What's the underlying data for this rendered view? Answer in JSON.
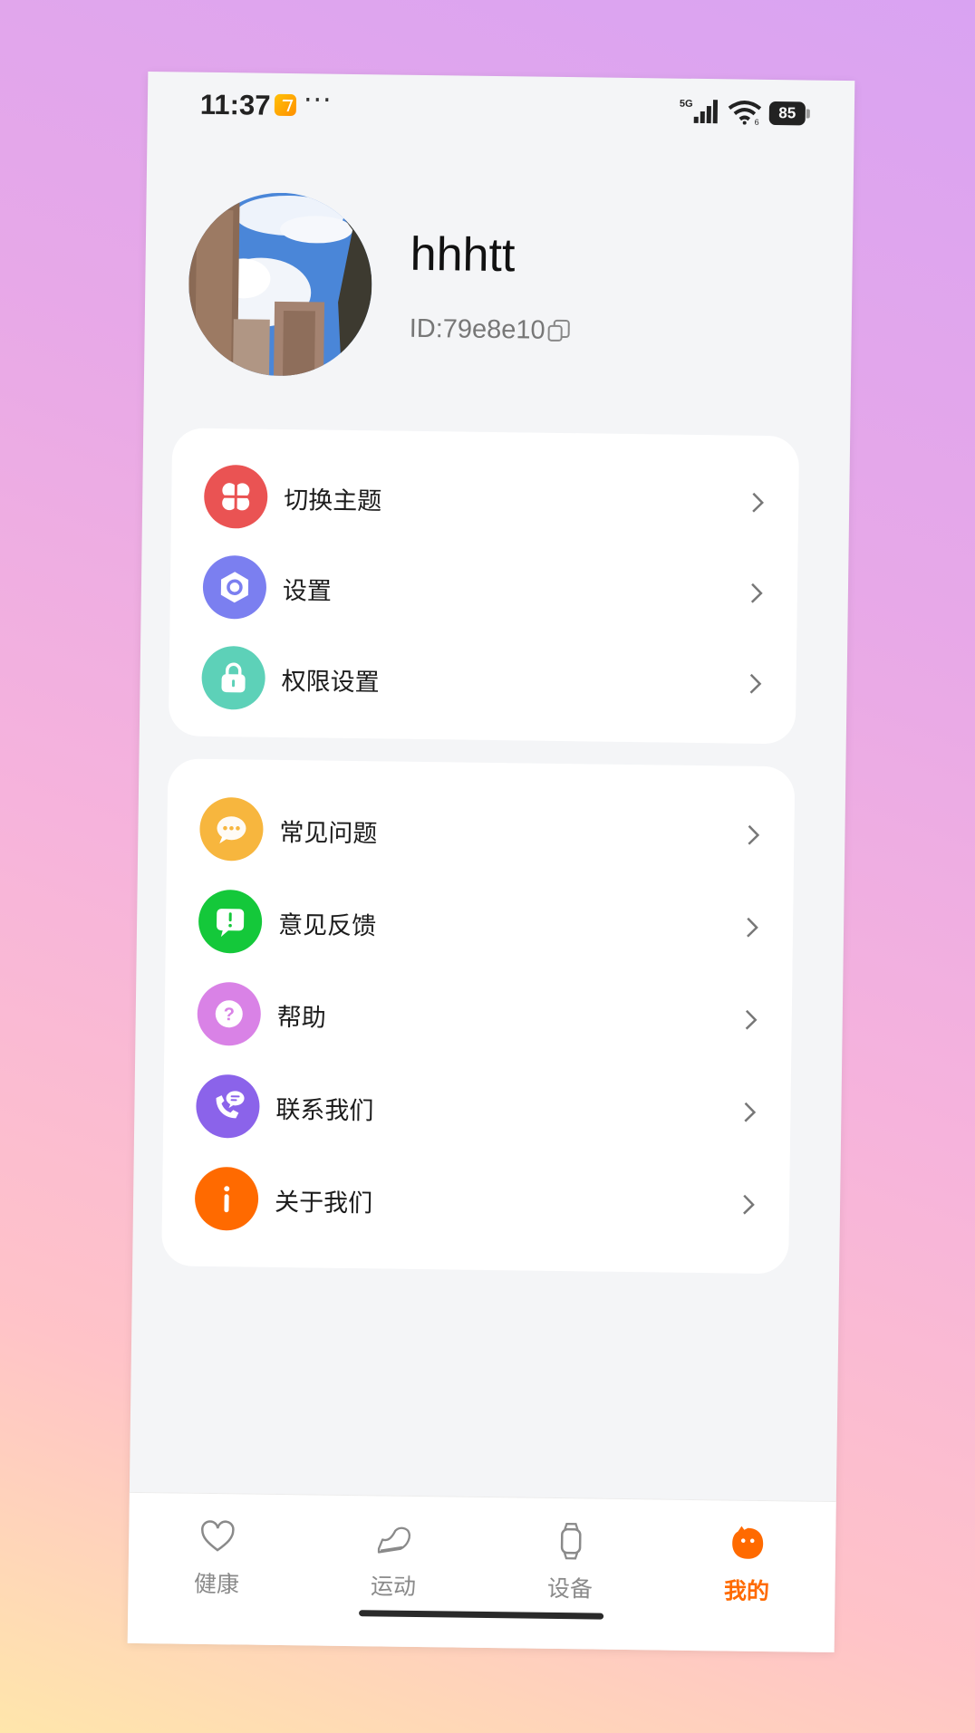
{
  "status_bar": {
    "time": "11:37",
    "more": "···",
    "network": "5G",
    "battery": "85"
  },
  "profile": {
    "username": "hhhtt",
    "id_text": "ID:79e8e10"
  },
  "menu_group_1": [
    {
      "label": "切换主题",
      "icon": "theme-icon",
      "color": "#ea5353"
    },
    {
      "label": "设置",
      "icon": "settings-icon",
      "color": "#7b7ff0"
    },
    {
      "label": "权限设置",
      "icon": "lock-icon",
      "color": "#5dd1b8"
    }
  ],
  "menu_group_2": [
    {
      "label": "常见问题",
      "icon": "chat-bubble-icon",
      "color": "#f7b63e"
    },
    {
      "label": "意见反馈",
      "icon": "feedback-icon",
      "color": "#14c83a"
    },
    {
      "label": "帮助",
      "icon": "help-icon",
      "color": "#d982e6"
    },
    {
      "label": "联系我们",
      "icon": "phone-icon",
      "color": "#8b63ea"
    },
    {
      "label": "关于我们",
      "icon": "info-icon",
      "color": "#ff6a00"
    }
  ],
  "tabbar": {
    "tabs": [
      {
        "label": "健康",
        "icon": "heart-icon"
      },
      {
        "label": "运动",
        "icon": "shoe-icon"
      },
      {
        "label": "设备",
        "icon": "watch-icon"
      },
      {
        "label": "我的",
        "icon": "face-icon",
        "active": true
      }
    ],
    "active_color": "#ff6a00"
  }
}
